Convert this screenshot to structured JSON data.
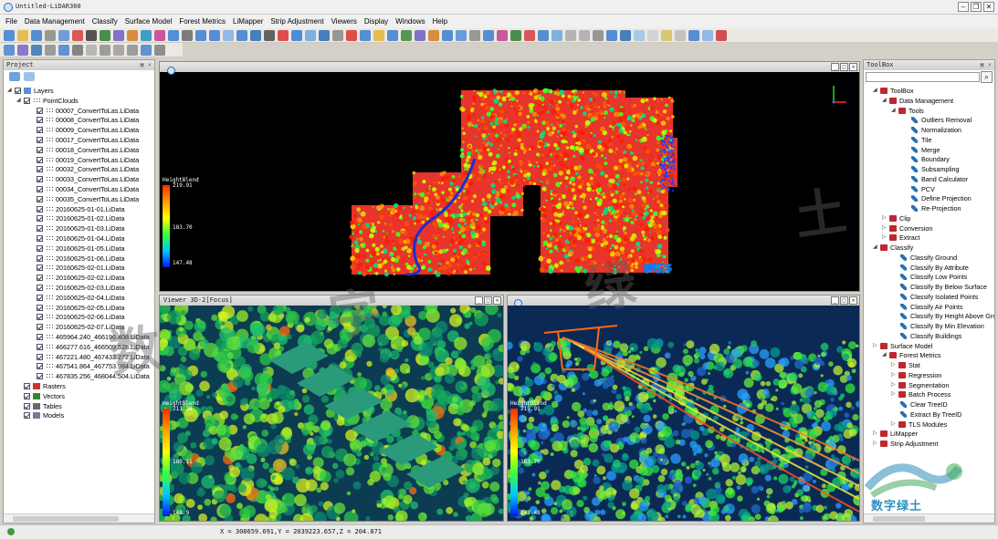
{
  "window": {
    "title": "Untitled-LiDAR360"
  },
  "menu": [
    "File",
    "Data Management",
    "Classify",
    "Surface Model",
    "Forest Metrics",
    "LiMapper",
    "Strip Adjustment",
    "Viewers",
    "Display",
    "Windows",
    "Help"
  ],
  "project_panel": {
    "title": "Project",
    "layers_label": "Layers",
    "pointclouds_label": "PointClouds",
    "files": [
      "00007_ConvertToLas.LiData",
      "00008_ConvertToLas.LiData",
      "00009_ConvertToLas.LiData",
      "00017_ConvertToLas.LiData",
      "00018_ConvertToLas.LiData",
      "00019_ConvertToLas.LiData",
      "00032_ConvertToLas.LiData",
      "00033_ConvertToLas.LiData",
      "00034_ConvertToLas.LiData",
      "00035_ConvertToLas.LiData",
      "20160625-01-01.LiData",
      "20160625-01-02.LiData",
      "20160625-01-03.LiData",
      "20160625-01-04.LiData",
      "20160625-01-05.LiData",
      "20160625-01-06.LiData",
      "20160625-02-01.LiData",
      "20160625-02-02.LiData",
      "20160625-02-03.LiData",
      "20160625-02-04.LiData",
      "20160625-02-05.LiData",
      "20160625-02-06.LiData",
      "20160625-02-07.LiData",
      "465964.240_466196.408.LiData",
      "466277.616_466509.528.LiData",
      "467221.480_467433.272.LiData",
      "467541.864_467753.984.LiData",
      "467835.256_468044.504.LiData"
    ],
    "groups": [
      "Rasters",
      "Vectors",
      "Tables",
      "Models"
    ]
  },
  "toolbox_panel": {
    "title": "ToolBox",
    "items": [
      {
        "label": "ToolBox",
        "type": "box",
        "arrow": "◢"
      },
      {
        "label": "Data Management",
        "type": "box",
        "arrow": "◢"
      },
      {
        "label": "Tools",
        "type": "box",
        "arrow": "◢"
      },
      {
        "label": "Outliers Removal",
        "type": "tool",
        "arrow": ""
      },
      {
        "label": "Normalization",
        "type": "tool",
        "arrow": ""
      },
      {
        "label": "Tile",
        "type": "tool",
        "arrow": ""
      },
      {
        "label": "Merge",
        "type": "tool",
        "arrow": ""
      },
      {
        "label": "Boundary",
        "type": "tool",
        "arrow": ""
      },
      {
        "label": "Subsampling",
        "type": "tool",
        "arrow": ""
      },
      {
        "label": "Band Calculator",
        "type": "tool",
        "arrow": ""
      },
      {
        "label": "PCV",
        "type": "tool",
        "arrow": ""
      },
      {
        "label": "Define Projection",
        "type": "tool",
        "arrow": ""
      },
      {
        "label": "Re-Projection",
        "type": "tool",
        "arrow": ""
      },
      {
        "label": "Clip",
        "type": "box",
        "arrow": "▷"
      },
      {
        "label": "Conversion",
        "type": "box",
        "arrow": "▷"
      },
      {
        "label": "Extract",
        "type": "box",
        "arrow": "▷"
      },
      {
        "label": "Classify",
        "type": "box",
        "arrow": "◢"
      },
      {
        "label": "Classify Ground",
        "type": "tool",
        "arrow": ""
      },
      {
        "label": "Classify By Attribute",
        "type": "tool",
        "arrow": ""
      },
      {
        "label": "Classify Low Points",
        "type": "tool",
        "arrow": ""
      },
      {
        "label": "Classify By Below Surface",
        "type": "tool",
        "arrow": ""
      },
      {
        "label": "Classify Isolated Points",
        "type": "tool",
        "arrow": ""
      },
      {
        "label": "Classify Air Points",
        "type": "tool",
        "arrow": ""
      },
      {
        "label": "Classify By Height Above Gro",
        "type": "tool",
        "arrow": ""
      },
      {
        "label": "Classify By Min Elevation",
        "type": "tool",
        "arrow": ""
      },
      {
        "label": "Classify Buildings",
        "type": "tool",
        "arrow": ""
      },
      {
        "label": "Surface Model",
        "type": "box",
        "arrow": "▷"
      },
      {
        "label": "Forest Metrics",
        "type": "box",
        "arrow": "◢"
      },
      {
        "label": "Stat",
        "type": "box",
        "arrow": "▷"
      },
      {
        "label": "Regression",
        "type": "box",
        "arrow": "▷"
      },
      {
        "label": "Segmentation",
        "type": "box",
        "arrow": "▷"
      },
      {
        "label": "Batch Process",
        "type": "box",
        "arrow": "▷"
      },
      {
        "label": "Clear TreeID",
        "type": "tool",
        "arrow": ""
      },
      {
        "label": "Extract By TreeID",
        "type": "tool",
        "arrow": ""
      },
      {
        "label": "TLS Modules",
        "type": "box",
        "arrow": "▷"
      },
      {
        "label": "LiMapper",
        "type": "box",
        "arrow": "▷"
      },
      {
        "label": "Strip Adjustment",
        "type": "box",
        "arrow": "▷"
      }
    ]
  },
  "viewers": {
    "main": {
      "title": "",
      "legend_title": "HeightBlend",
      "max": "219.91",
      "mid": "183.70",
      "min": "147.48"
    },
    "v2": {
      "title": "Viewer 3D-2[Focus]",
      "legend_title": "HeightBlend",
      "max": "211.38",
      "mid": "180.11",
      "min": "148.9"
    },
    "v3": {
      "title": "",
      "legend_title": "HeightBlend",
      "max": "219.91",
      "mid": "183.70",
      "min": "147.48"
    }
  },
  "status": {
    "coords": "X = 308659.691,Y = 2039223.657,Z = 204.871"
  },
  "watermark": {
    "chars": [
      "数",
      "字",
      "绿",
      "土"
    ],
    "logo_text": "数字绿土"
  }
}
